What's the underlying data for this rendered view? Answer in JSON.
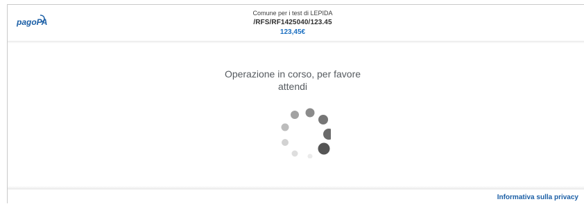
{
  "header": {
    "logo_text": "pagoPA",
    "organization": "Comune per i test di LEPIDA",
    "notice_code": "/RFS/RF1425040/123.45",
    "amount": "123,45€"
  },
  "main": {
    "status_message_line1": "Operazione in corso, per favore",
    "status_message_line2": "attendi",
    "spinner_icon": "loading-spinner-icon"
  },
  "footer": {
    "privacy_link": "Informativa sulla privacy"
  },
  "colors": {
    "brand_blue": "#1b5fa6",
    "amount_blue": "#1b6fc1",
    "text_gray": "#555a5f"
  }
}
